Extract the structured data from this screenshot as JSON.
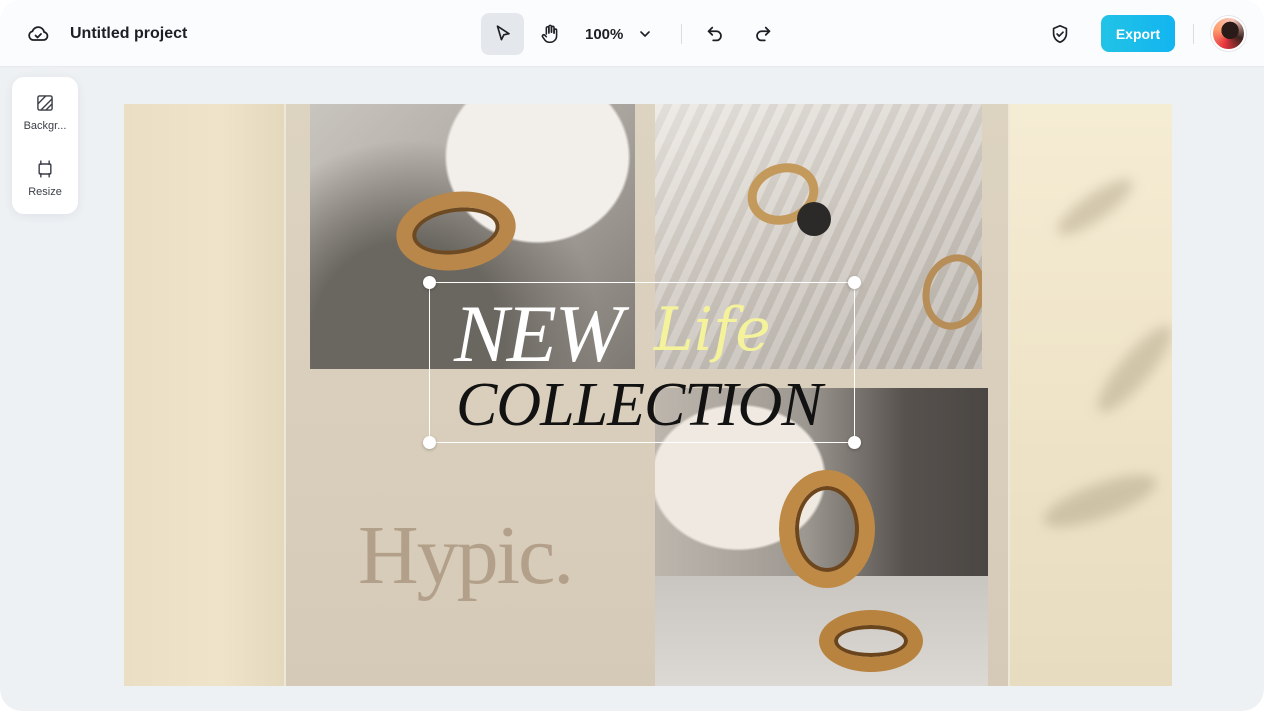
{
  "topbar": {
    "cloud_icon": "cloud-sync-icon",
    "project_title": "Untitled project",
    "tools": {
      "select_icon": "cursor-arrow-icon",
      "hand_icon": "hand-pan-icon",
      "zoom_value": "100%",
      "zoom_icon": "chevron-down-icon",
      "undo_icon": "undo-icon",
      "redo_icon": "redo-icon"
    },
    "shield_icon": "shield-check-icon",
    "export_label": "Export",
    "accent_color": "#18bdeb"
  },
  "side_panel": {
    "items": [
      {
        "label": "Backgr...",
        "icon": "background-pattern-icon"
      },
      {
        "label": "Resize",
        "icon": "resize-frame-icon"
      }
    ]
  },
  "canvas": {
    "headline_1": "NEW",
    "headline_2": "Life",
    "headline_3": "COLLECTION",
    "brand": "Hypic.",
    "colors": {
      "life_text": "#f4f29a",
      "brand_text": "#b3a08a",
      "collection_text": "#121212"
    }
  }
}
